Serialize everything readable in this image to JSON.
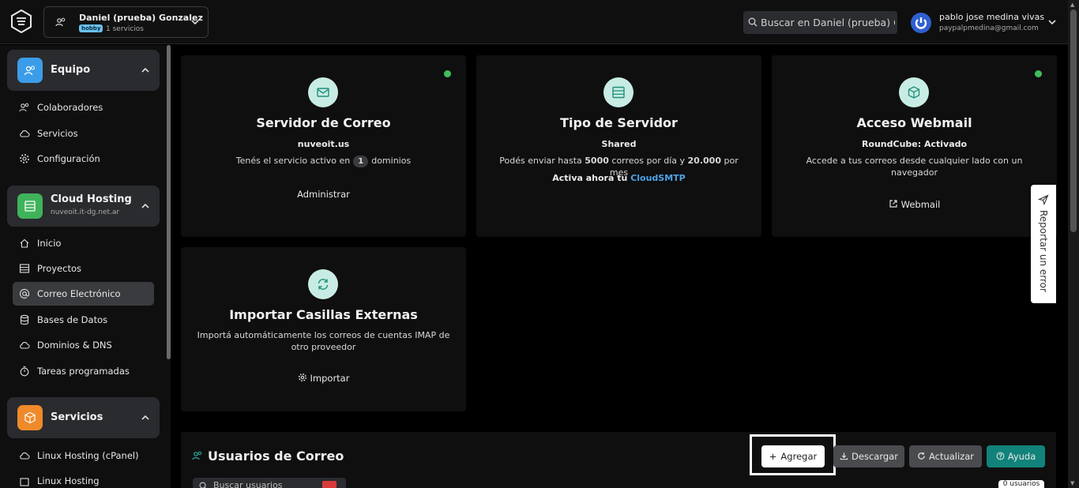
{
  "header": {
    "account": {
      "name": "Daniel (prueba) Gonzalez",
      "badge": "hobby",
      "services": "1 servicios"
    },
    "search_placeholder": "Buscar en Daniel (prueba) G",
    "user": {
      "name": "pablo jose medina vivas",
      "email": "paypalpmedina@gmail.com"
    }
  },
  "sidebar": {
    "groups": [
      {
        "title": "Equipo",
        "subtitle": "",
        "color": "#3b9de8",
        "items": [
          {
            "label": "Colaboradores",
            "icon": "users-icon"
          },
          {
            "label": "Servicios",
            "icon": "cloud-icon"
          },
          {
            "label": "Configuración",
            "icon": "gear-icon"
          }
        ]
      },
      {
        "title": "Cloud Hosting",
        "subtitle": "nuveoit.it-dg.net.ar",
        "color": "#3fb35a",
        "items": [
          {
            "label": "Inicio",
            "icon": "home-icon"
          },
          {
            "label": "Proyectos",
            "icon": "list-icon"
          },
          {
            "label": "Correo Electrónico",
            "icon": "at-icon",
            "active": true
          },
          {
            "label": "Bases de Datos",
            "icon": "database-icon"
          },
          {
            "label": "Dominios & DNS",
            "icon": "cloud-icon"
          },
          {
            "label": "Tareas programadas",
            "icon": "timer-icon"
          }
        ]
      },
      {
        "title": "Servicios",
        "subtitle": "",
        "color": "#ef8a2a",
        "items": [
          {
            "label": "Linux Hosting (cPanel)",
            "icon": "cloud-icon"
          },
          {
            "label": "Linux Hosting",
            "icon": "square-icon"
          }
        ]
      }
    ]
  },
  "cards": {
    "mail_server": {
      "title": "Servidor de Correo",
      "domain": "nuveoit.us",
      "text_before": "Tenés el servicio activo en",
      "count": "1",
      "text_after": "dominios",
      "link": "Administrar",
      "icon": "mail-icon"
    },
    "server_type": {
      "title": "Tipo de Servidor",
      "type": "Shared",
      "l1_a": "Podés enviar hasta",
      "l1_b": "5000",
      "l1_c": "correos por día y",
      "l1_d": "20.000",
      "l1_e": "por mes",
      "l2_a": "Activa ahora tu",
      "l2_link": "CloudSMTP",
      "icon": "server-icon"
    },
    "webmail": {
      "title": "Acceso Webmail",
      "status": "RoundCube: Activado",
      "text": "Accede a tus correos desde cualquier lado con un navegador",
      "link": "Webmail",
      "icon": "box-icon"
    },
    "import": {
      "title": "Importar Casillas Externas",
      "text": "Importá automáticamente los correos de cuentas IMAP de otro proveedor",
      "link": "Importar",
      "icon": "refresh-icon"
    }
  },
  "report": {
    "label": "Reportar un error"
  },
  "users": {
    "title": "Usuarios de Correo",
    "buttons": {
      "add": "Agregar",
      "download": "Descargar",
      "refresh": "Actualizar",
      "help": "Ayuda"
    },
    "search_placeholder": "Buscar usuarios",
    "count": "0 usuarios"
  },
  "colors": {
    "accent": "#12837a",
    "status": "#3fbf5a",
    "icon_bg": "#c8ece3"
  }
}
